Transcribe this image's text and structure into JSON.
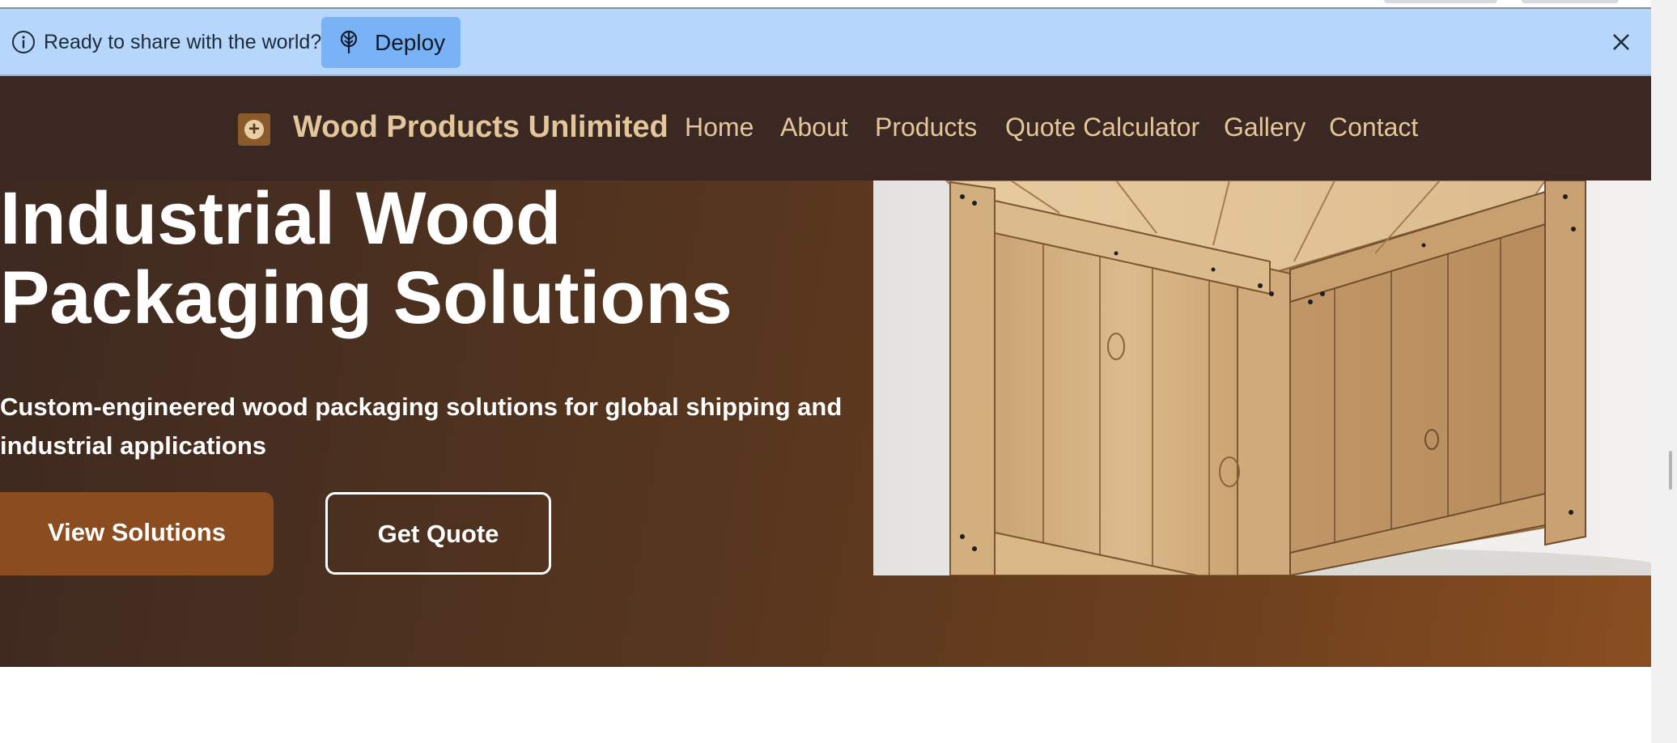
{
  "deploy_banner": {
    "message": "Ready to share with the world?",
    "button_label": "Deploy"
  },
  "navbar": {
    "brand": "Wood Products Unlimited",
    "links": [
      "Home",
      "About",
      "Products",
      "Quote Calculator",
      "Gallery",
      "Contact"
    ]
  },
  "hero": {
    "title_line1": "Industrial Wood",
    "title_line2": "Packaging Solutions",
    "subtitle_line1": "Custom-engineered wood packaging solutions for global shipping and",
    "subtitle_line2": "industrial applications",
    "primary_button": "View Solutions",
    "secondary_button": "Get Quote"
  },
  "colors": {
    "banner_bg": "#b6d6fb",
    "deploy_button": "#7ab3f5",
    "nav_bg": "#3b2822",
    "nav_text": "#e3c79b",
    "accent_brown": "#8b4c1f"
  },
  "icons": {
    "info": "info-icon",
    "deploy": "tree-icon",
    "close": "close-icon",
    "logo": "plus-circle-icon"
  }
}
